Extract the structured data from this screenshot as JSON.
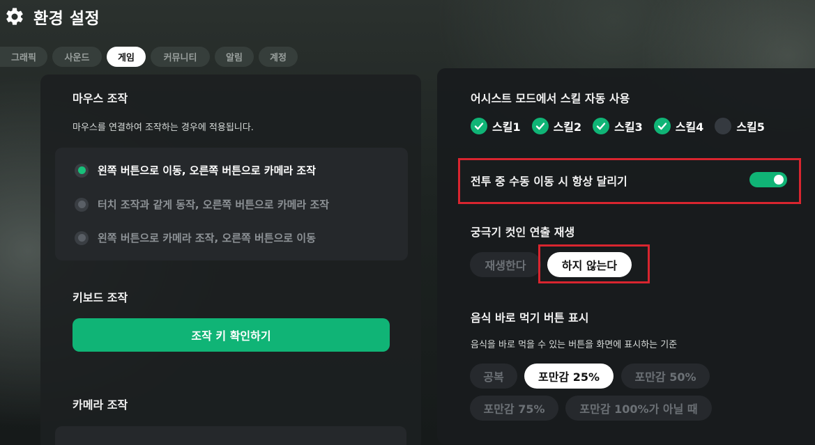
{
  "header": {
    "title": "환경 설정",
    "icon": "gear-icon"
  },
  "tabs": [
    {
      "label": "그래픽",
      "active": false
    },
    {
      "label": "사운드",
      "active": false
    },
    {
      "label": "게임",
      "active": true
    },
    {
      "label": "커뮤니티",
      "active": false
    },
    {
      "label": "알림",
      "active": false
    },
    {
      "label": "계정",
      "active": false
    }
  ],
  "mouse": {
    "title": "마우스 조작",
    "desc": "마우스를 연결하여 조작하는 경우에 적용됩니다.",
    "options": [
      {
        "label": "왼쪽 버튼으로 이동, 오른쪽 버튼으로 카메라 조작",
        "selected": true
      },
      {
        "label": "터치 조작과 같게 동작, 오른쪽 버튼으로 카메라 조작",
        "selected": false
      },
      {
        "label": "왼쪽 버튼으로 카메라 조작, 오른쪽 버튼으로 이동",
        "selected": false
      }
    ]
  },
  "keyboard": {
    "title": "키보드 조작",
    "button": "조작 키 확인하기"
  },
  "camera": {
    "title": "카메라 조작"
  },
  "assist": {
    "title": "어시스트 모드에서 스킬 자동 사용",
    "skills": [
      {
        "label": "스킬1",
        "checked": true
      },
      {
        "label": "스킬2",
        "checked": true
      },
      {
        "label": "스킬3",
        "checked": true
      },
      {
        "label": "스킬4",
        "checked": true
      },
      {
        "label": "스킬5",
        "checked": false
      }
    ]
  },
  "always_run": {
    "label": "전투 중 수동 이동 시 항상 달리기",
    "enabled": true
  },
  "ultimate": {
    "title": "궁극기 컷인 연출 재생",
    "options": [
      {
        "label": "재생한다",
        "selected": false
      },
      {
        "label": "하지 않는다",
        "selected": true
      }
    ]
  },
  "food": {
    "title": "음식 바로 먹기 버튼 표시",
    "desc": "음식을 바로 먹을 수 있는 버튼을 화면에 표시하는 기준",
    "options": [
      {
        "label": "공복",
        "selected": false
      },
      {
        "label": "포만감 25%",
        "selected": true
      },
      {
        "label": "포만감 50%",
        "selected": false
      },
      {
        "label": "포만감 75%",
        "selected": false
      },
      {
        "label": "포만감 100%가 아닐 때",
        "selected": false
      }
    ]
  },
  "colors": {
    "accent": "#10b476",
    "highlight": "#d9252f"
  }
}
